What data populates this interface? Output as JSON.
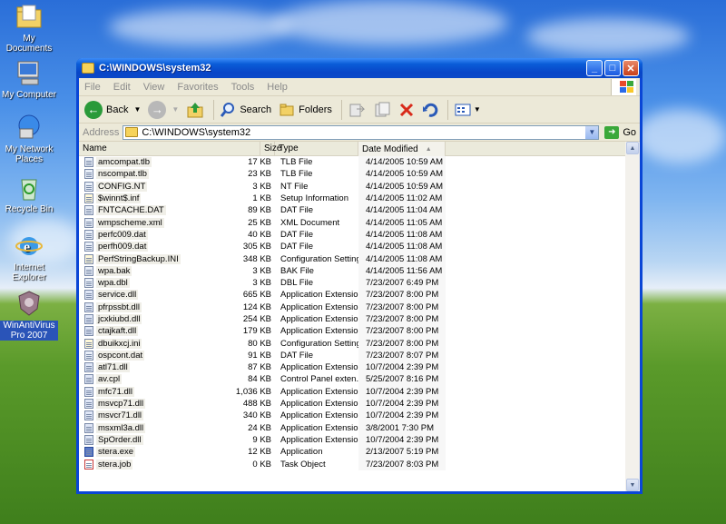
{
  "desktop": {
    "icons": [
      {
        "label": "My Documents"
      },
      {
        "label": "My Computer"
      },
      {
        "label": "My Network Places"
      },
      {
        "label": "Recycle Bin"
      },
      {
        "label": "Internet Explorer"
      },
      {
        "label": "WinAntiVirus Pro 2007"
      }
    ]
  },
  "window": {
    "title": "C:\\WINDOWS\\system32",
    "menu": [
      "File",
      "Edit",
      "View",
      "Favorites",
      "Tools",
      "Help"
    ],
    "toolbar": {
      "back": "Back",
      "search": "Search",
      "folders": "Folders"
    },
    "address": {
      "label": "Address",
      "value": "C:\\WINDOWS\\system32",
      "go": "Go"
    },
    "columns": {
      "name": "Name",
      "size": "Size",
      "type": "Type",
      "date": "Date Modified"
    },
    "files": [
      {
        "name": "amcompat.tlb",
        "size": "17 KB",
        "type": "TLB File",
        "date": "4/14/2005 10:59 AM",
        "icon": "doc"
      },
      {
        "name": "nscompat.tlb",
        "size": "23 KB",
        "type": "TLB File",
        "date": "4/14/2005 10:59 AM",
        "icon": "doc"
      },
      {
        "name": "CONFIG.NT",
        "size": "3 KB",
        "type": "NT File",
        "date": "4/14/2005 10:59 AM",
        "icon": "doc"
      },
      {
        "name": "$winnt$.inf",
        "size": "1 KB",
        "type": "Setup Information",
        "date": "4/14/2005 11:02 AM",
        "icon": "ini"
      },
      {
        "name": "FNTCACHE.DAT",
        "size": "89 KB",
        "type": "DAT File",
        "date": "4/14/2005 11:04 AM",
        "icon": "doc"
      },
      {
        "name": "wmpscheme.xml",
        "size": "25 KB",
        "type": "XML Document",
        "date": "4/14/2005 11:05 AM",
        "icon": "doc"
      },
      {
        "name": "perfc009.dat",
        "size": "40 KB",
        "type": "DAT File",
        "date": "4/14/2005 11:08 AM",
        "icon": "doc"
      },
      {
        "name": "perfh009.dat",
        "size": "305 KB",
        "type": "DAT File",
        "date": "4/14/2005 11:08 AM",
        "icon": "doc"
      },
      {
        "name": "PerfStringBackup.INI",
        "size": "348 KB",
        "type": "Configuration Settings",
        "date": "4/14/2005 11:08 AM",
        "icon": "ini"
      },
      {
        "name": "wpa.bak",
        "size": "3 KB",
        "type": "BAK File",
        "date": "4/14/2005 11:56 AM",
        "icon": "doc"
      },
      {
        "name": "wpa.dbl",
        "size": "3 KB",
        "type": "DBL File",
        "date": "7/23/2007 6:49 PM",
        "icon": "doc"
      },
      {
        "name": "service.dll",
        "size": "665 KB",
        "type": "Application Extension",
        "date": "7/23/2007 8:00 PM",
        "icon": "dll"
      },
      {
        "name": "pfrpssbt.dll",
        "size": "124 KB",
        "type": "Application Extension",
        "date": "7/23/2007 8:00 PM",
        "icon": "dll"
      },
      {
        "name": "jcxkiubd.dll",
        "size": "254 KB",
        "type": "Application Extension",
        "date": "7/23/2007 8:00 PM",
        "icon": "dll"
      },
      {
        "name": "ctajkaft.dll",
        "size": "179 KB",
        "type": "Application Extension",
        "date": "7/23/2007 8:00 PM",
        "icon": "dll"
      },
      {
        "name": "dbuikxcj.ini",
        "size": "80 KB",
        "type": "Configuration Settings",
        "date": "7/23/2007 8:00 PM",
        "icon": "ini"
      },
      {
        "name": "ospcont.dat",
        "size": "91 KB",
        "type": "DAT File",
        "date": "7/23/2007 8:07 PM",
        "icon": "doc"
      },
      {
        "name": "atl71.dll",
        "size": "87 KB",
        "type": "Application Extension",
        "date": "10/7/2004 2:39 PM",
        "icon": "dll"
      },
      {
        "name": "av.cpl",
        "size": "84 KB",
        "type": "Control Panel exten...",
        "date": "5/25/2007 8:16 PM",
        "icon": "dll"
      },
      {
        "name": "mfc71.dll",
        "size": "1,036 KB",
        "type": "Application Extension",
        "date": "10/7/2004 2:39 PM",
        "icon": "dll"
      },
      {
        "name": "msvcp71.dll",
        "size": "488 KB",
        "type": "Application Extension",
        "date": "10/7/2004 2:39 PM",
        "icon": "dll"
      },
      {
        "name": "msvcr71.dll",
        "size": "340 KB",
        "type": "Application Extension",
        "date": "10/7/2004 2:39 PM",
        "icon": "dll"
      },
      {
        "name": "msxml3a.dll",
        "size": "24 KB",
        "type": "Application Extension",
        "date": "3/8/2001 7:30 PM",
        "icon": "dll"
      },
      {
        "name": "SpOrder.dll",
        "size": "9 KB",
        "type": "Application Extension",
        "date": "10/7/2004 2:39 PM",
        "icon": "dll"
      },
      {
        "name": "stera.exe",
        "size": "12 KB",
        "type": "Application",
        "date": "2/13/2007 5:19 PM",
        "icon": "app"
      },
      {
        "name": "stera.job",
        "size": "0 KB",
        "type": "Task Object",
        "date": "7/23/2007 8:03 PM",
        "icon": "job"
      }
    ]
  }
}
